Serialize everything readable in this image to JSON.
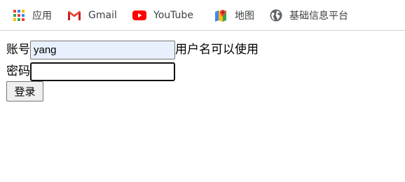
{
  "bookmarks": {
    "apps": {
      "label": "应用",
      "icon": "apps-grid-icon"
    },
    "gmail": {
      "label": "Gmail",
      "icon": "gmail-icon"
    },
    "youtube": {
      "label": "YouTube",
      "icon": "youtube-icon"
    },
    "maps": {
      "label": "地图",
      "icon": "maps-icon"
    },
    "site": {
      "label": "基础信息平台",
      "icon": "globe-icon"
    }
  },
  "form": {
    "account_label": "账号",
    "account_value": "yang",
    "account_hint": "用户名可以使用",
    "password_label": "密码",
    "password_value": "",
    "login_button": "登录"
  },
  "colors": {
    "autofill_bg": "#e8f0fe",
    "youtube_red": "#ff0000",
    "gmail_red": "#ea4335"
  }
}
